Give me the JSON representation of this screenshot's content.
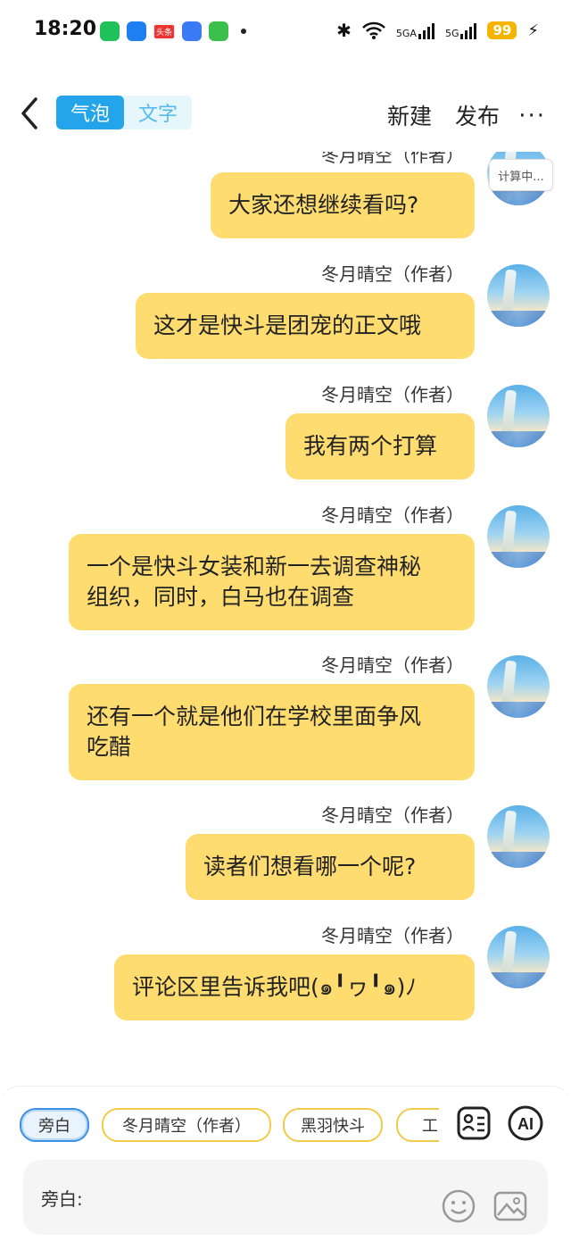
{
  "status_bar": {
    "time": "18:20",
    "battery": "99",
    "sig1": "5GA",
    "sig2": "5G",
    "news_app": "头条"
  },
  "header": {
    "seg_bubble": "气泡",
    "seg_text": "文字",
    "new_label": "新建",
    "publish_label": "发布",
    "more_label": "···"
  },
  "calc_badge": "计算中...",
  "messages": [
    {
      "name": "冬月晴空（作者）",
      "text": "大家还想继续看吗?"
    },
    {
      "name": "冬月晴空（作者）",
      "text": "这才是快斗是团宠的正文哦"
    },
    {
      "name": "冬月晴空（作者）",
      "text": "我有两个打算"
    },
    {
      "name": "冬月晴空（作者）",
      "line1": "一个是快斗女装和新一去调查神秘",
      "line2": "组织，同时，白马也在调查"
    },
    {
      "name": "冬月晴空（作者）",
      "line1": "还有一个就是他们在学校里面争风",
      "line2": "吃醋"
    },
    {
      "name": "冬月晴空（作者）",
      "text": "读者们想看哪一个呢?"
    },
    {
      "name": "冬月晴空（作者）",
      "text": "评论区里告诉我吧(๑╹ヮ╹๑)ﾉ"
    }
  ],
  "roles": [
    "旁白",
    "冬月晴空（作者）",
    "黑羽快斗",
    "工藤"
  ],
  "input": {
    "label": "旁白:",
    "value": ""
  },
  "colors": {
    "bubble": "#fedc70",
    "accent": "#24a4ea",
    "chip_border": "#f0cb4a"
  },
  "icons": [
    "back-icon",
    "role-card-icon",
    "ai-icon",
    "emoji-icon",
    "image-icon"
  ]
}
